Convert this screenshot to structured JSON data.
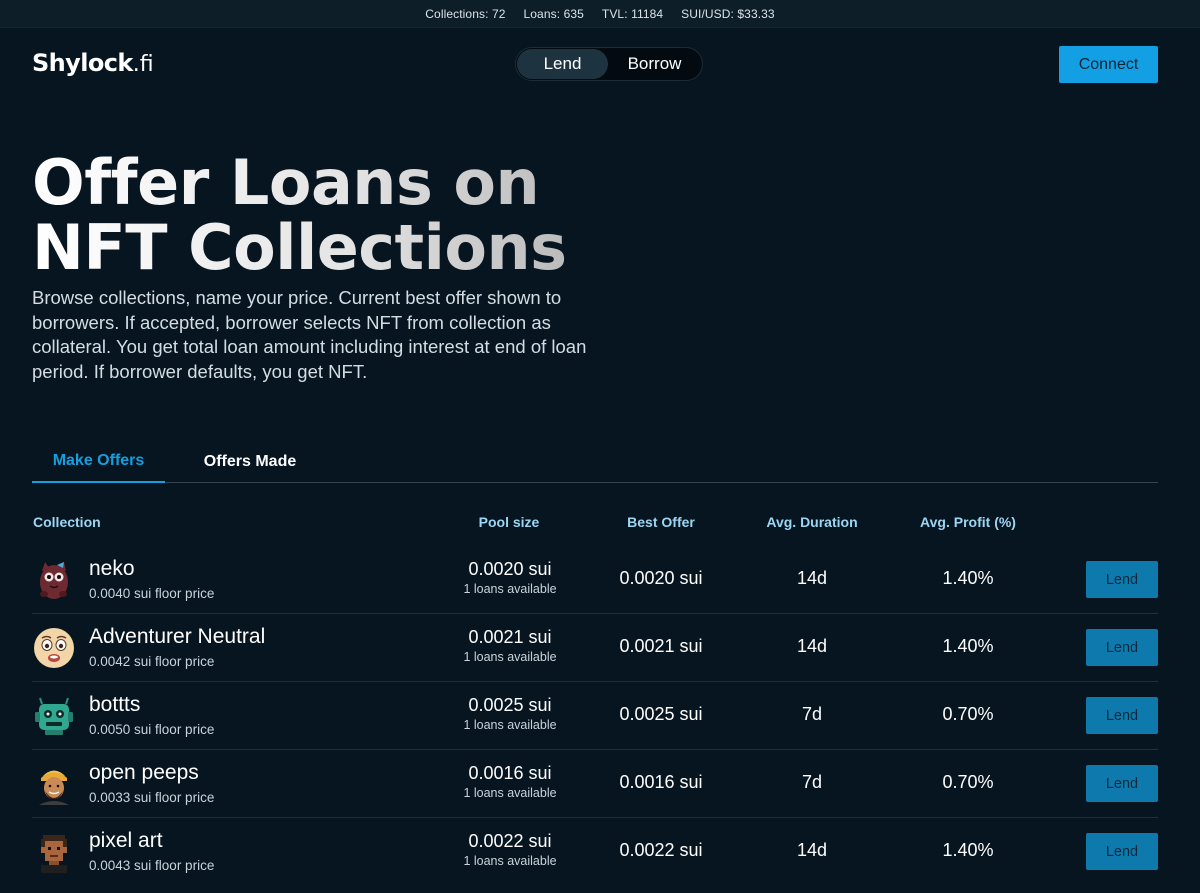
{
  "stats": {
    "collections": "Collections: 72",
    "loans": "Loans: 635",
    "tvl": "TVL: 11184",
    "price": "SUI/USD: $33.33"
  },
  "header": {
    "logo_main": "Shylock",
    "logo_suffix": ".fi",
    "toggle": {
      "lend": "Lend",
      "borrow": "Borrow",
      "selected": "Lend"
    },
    "connect_label": "Connect"
  },
  "hero": {
    "title_line1": "Offer Loans on",
    "title_line2": "NFT Collections",
    "description": "Browse collections, name your price. Current best offer shown to borrowers. If accepted, borrower selects NFT from collection as collateral. You get total loan amount including interest at end of loan period. If borrower defaults, you get NFT."
  },
  "tabs": [
    {
      "label": "Make Offers",
      "active": true
    },
    {
      "label": "Offers Made",
      "active": false
    }
  ],
  "table": {
    "headers": {
      "collection": "Collection",
      "pool_size": "Pool size",
      "best_offer": "Best Offer",
      "avg_duration": "Avg. Duration",
      "avg_profit": "Avg. Profit (%)"
    },
    "lend_label": "Lend",
    "rows": [
      {
        "avatar": "neko-cat-avatar-icon",
        "name": "neko",
        "floor": "0.0040 sui floor price",
        "pool": "0.0020 sui",
        "available": "1 loans available",
        "best_offer": "0.0020 sui",
        "duration": "14d",
        "profit": "1.40%"
      },
      {
        "avatar": "adventurer-face-avatar-icon",
        "name": "Adventurer Neutral",
        "floor": "0.0042 sui floor price",
        "pool": "0.0021 sui",
        "available": "1 loans available",
        "best_offer": "0.0021 sui",
        "duration": "14d",
        "profit": "1.40%"
      },
      {
        "avatar": "robot-avatar-icon",
        "name": "bottts",
        "floor": "0.0050 sui floor price",
        "pool": "0.0025 sui",
        "available": "1 loans available",
        "best_offer": "0.0025 sui",
        "duration": "7d",
        "profit": "0.70%"
      },
      {
        "avatar": "turban-person-avatar-icon",
        "name": "open peeps",
        "floor": "0.0033 sui floor price",
        "pool": "0.0016 sui",
        "available": "1 loans available",
        "best_offer": "0.0016 sui",
        "duration": "7d",
        "profit": "0.70%"
      },
      {
        "avatar": "pixel-person-avatar-icon",
        "name": "pixel art",
        "floor": "0.0043 sui floor price",
        "pool": "0.0022 sui",
        "available": "1 loans available",
        "best_offer": "0.0022 sui",
        "duration": "14d",
        "profit": "1.40%"
      }
    ]
  },
  "colors": {
    "background": "#071520",
    "accent": "#139fe4",
    "lend_button": "#0e79ad",
    "header_text": "#9cd6f2"
  }
}
